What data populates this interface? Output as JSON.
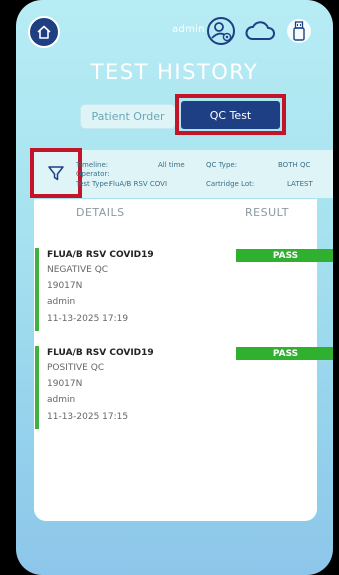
{
  "header": {
    "user_label": "admin",
    "icons": [
      "home-icon",
      "user-settings-icon",
      "cloud-icon",
      "usb-icon"
    ]
  },
  "page_title": "TEST HISTORY",
  "tabs": [
    {
      "label": "Patient Order",
      "active": false
    },
    {
      "label": "QC Test",
      "active": true
    }
  ],
  "filters": {
    "timeline_label": "Timeline:",
    "timeline_value": "All time",
    "operator_label": "Operator:",
    "operator_value": "",
    "test_type_label": "Test Type:",
    "test_type_value": "FluA/B RSV COVI",
    "qc_type_label": "QC Type:",
    "qc_type_value": "BOTH QC",
    "cartridge_lot_label": "Cartridge Lot:",
    "cartridge_lot_value": "LATEST"
  },
  "columns": {
    "details": "DETAILS",
    "result": "RESULT"
  },
  "results": [
    {
      "test_name": "FLUA/B RSV COVID19",
      "qc_type": "NEGATIVE QC",
      "lot": "19017N",
      "operator": "admin",
      "datetime": "11-13-2025 17:19",
      "result": "PASS"
    },
    {
      "test_name": "FLUA/B RSV COVID19",
      "qc_type": "POSITIVE QC",
      "lot": "19017N",
      "operator": "admin",
      "datetime": "11-13-2025 17:15",
      "result": "PASS"
    }
  ],
  "colors": {
    "navy": "#1f3f84",
    "highlight_red": "#c3142a",
    "pass_green": "#2fb02f"
  }
}
